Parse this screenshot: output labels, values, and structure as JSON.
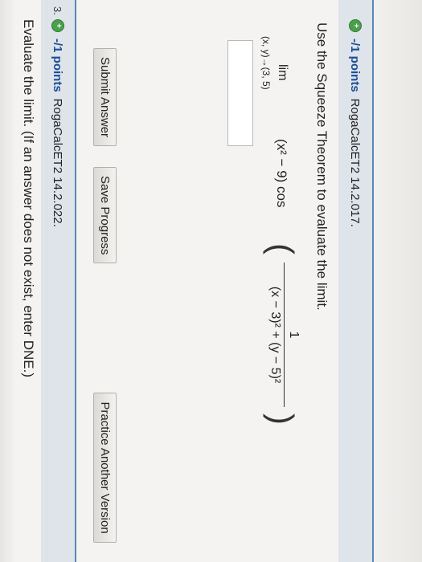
{
  "question1": {
    "points": "-/1 points",
    "code": "RogaCalcET2 14.2.017.",
    "prompt": "Use the Squeeze Theorem to evaluate the limit.",
    "limit_word": "lim",
    "limit_subscript": "(x, y)→(3, 5)",
    "factor": "(x² − 9) cos",
    "fraction_numerator": "1",
    "fraction_denominator": "(x − 3)² + (y − 5)²",
    "answer_value": ""
  },
  "buttons": {
    "submit": "Submit Answer",
    "save": "Save Progress",
    "practice": "Practice Another Version"
  },
  "question2": {
    "number": "3.",
    "points": "-/1 points",
    "code": "RogaCalcET2 14.2.022.",
    "prompt": "Evaluate the limit. (If an answer does not exist, enter DNE.)"
  }
}
